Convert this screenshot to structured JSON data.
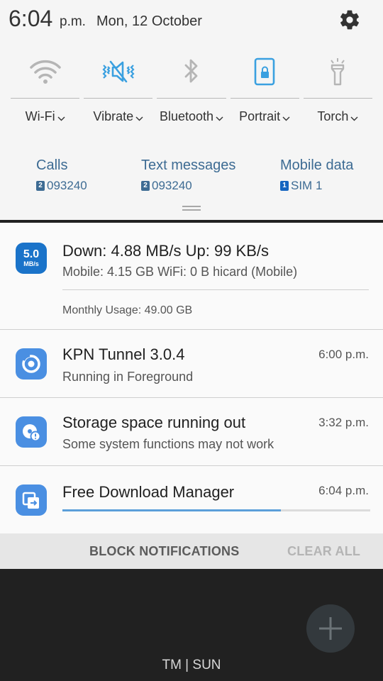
{
  "status": {
    "time": "6:04",
    "ampm": "p.m.",
    "date": "Mon, 12 October"
  },
  "quick_settings": [
    {
      "label": "Wi-Fi",
      "icon": "wifi-icon",
      "active": false
    },
    {
      "label": "Vibrate",
      "icon": "vibrate-icon",
      "active": true
    },
    {
      "label": "Bluetooth",
      "icon": "bluetooth-icon",
      "active": false
    },
    {
      "label": "Portrait",
      "icon": "portrait-lock-icon",
      "active": true
    },
    {
      "label": "Torch",
      "icon": "torch-icon",
      "active": false
    }
  ],
  "sim_settings": [
    {
      "title": "Calls",
      "badge": "2",
      "value": "093240"
    },
    {
      "title": "Text messages",
      "badge": "2",
      "value": "093240"
    },
    {
      "title": "Mobile data",
      "badge": "1",
      "value": "SIM 1"
    }
  ],
  "notifications": {
    "speed": {
      "icon_value": "5.0",
      "icon_unit": "MB/s",
      "title": "Down: 4.88 MB/s  Up: 99 KB/s",
      "text": "Mobile: 4.15 GB  WiFi: 0 B   hicard (Mobile)",
      "monthly": "Monthly Usage: 49.00 GB"
    },
    "kpn": {
      "title": "KPN Tunnel 3.0.4",
      "text": "Running in Foreground",
      "time": "6:00 p.m."
    },
    "storage": {
      "title": "Storage space running out",
      "text": "Some system functions may not work",
      "time": "3:32 p.m."
    },
    "fdm": {
      "title": "Free Download Manager",
      "time": "6:04 p.m.",
      "progress": 0.71
    }
  },
  "actions": {
    "block": "BLOCK NOTIFICATIONS",
    "clear": "CLEAR ALL"
  },
  "home": {
    "carrier": "TM | SUN"
  },
  "colors": {
    "accent": "#1a73c9",
    "sim_text": "#3d6b93",
    "active_icon": "#3aa0e0",
    "inactive_icon": "#b5b5b5"
  }
}
